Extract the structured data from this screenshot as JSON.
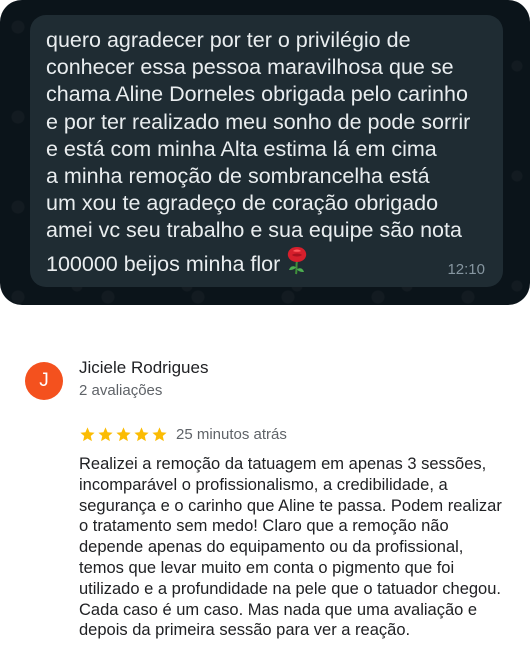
{
  "chat": {
    "message_text": "quero agradecer por ter o privilégio de\nconhecer essa pessoa maravilhosa que se\nchama Aline Dorneles obrigada pelo carinho\ne por ter realizado meu sonho de pode sorrir\ne está com minha Alta estima lá em cima\na minha remoção de sombrancelha está\num xou te agradeço de coração obrigado\namei vc seu trabalho e sua equipe são nota\n100000 beijos minha flor",
    "emoji_icon": "rose-icon",
    "time": "12:10",
    "colors": {
      "background": "#0b141a",
      "bubble": "#1f2c33",
      "text": "#e9edef",
      "time": "#8696a0"
    }
  },
  "review": {
    "avatar_letter": "J",
    "avatar_color": "#f4511e",
    "author": "Jiciele Rodrigues",
    "author_meta": "2 avaliações",
    "rating": 5,
    "rating_max": 5,
    "star_color": "#fbbc04",
    "time_ago": "25 minutos atrás",
    "text": "Realizei a remoção da tatuagem em apenas 3 sessões, incomparável o profissionalismo, a credibilidade, a segurança e o carinho que Aline te passa. Podem realizar o tratamento sem medo! Claro que a remoção não depende apenas do equipamento ou da profissional, temos que levar muito em conta o pigmento que foi utilizado e a profundidade na pele que o tatuador chegou. Cada caso é um caso. Mas nada que uma avaliação e depois da primeira sessão para ver a reação."
  }
}
